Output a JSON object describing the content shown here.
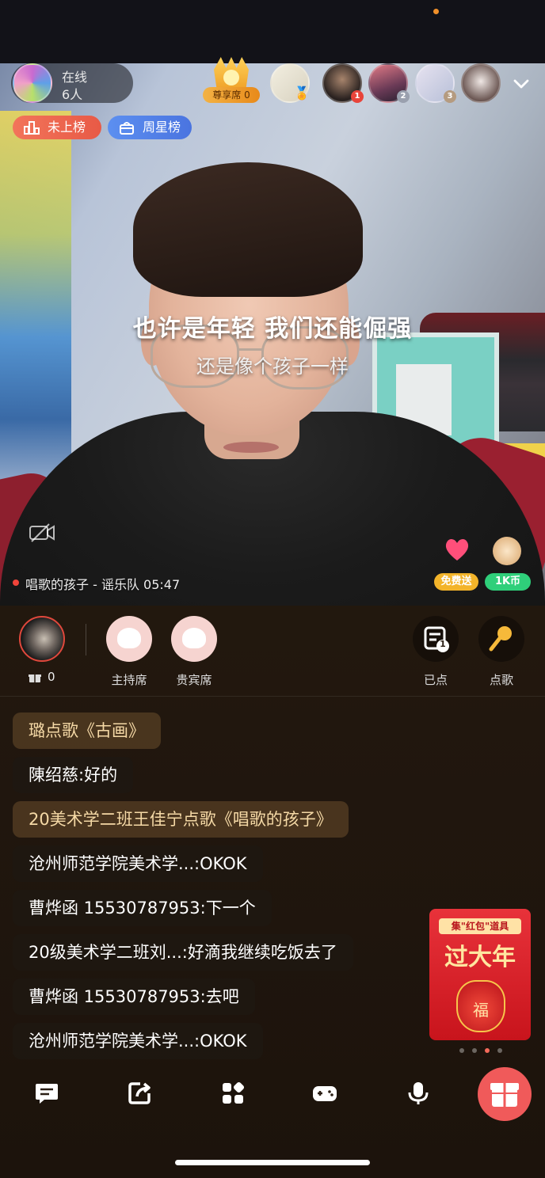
{
  "online": {
    "label": "在线",
    "count": "6人"
  },
  "vip_seat": {
    "label": "尊享席 0"
  },
  "viewers": [
    {
      "rank": ""
    },
    {
      "rank": "1"
    },
    {
      "rank": "2"
    },
    {
      "rank": "3"
    },
    {
      "rank": ""
    }
  ],
  "rank_pills": {
    "rank": "未上榜",
    "star": "周星榜"
  },
  "lyrics": {
    "line1": "也许是年轻 我们还能倔强",
    "line2": "还是像个孩子一样"
  },
  "now_playing": "唱歌的孩子 - 谣乐队 05:47",
  "gifts": {
    "free_label": "免费送",
    "coin_label": "1K币"
  },
  "host": {
    "gift_count": "0"
  },
  "seats": [
    {
      "label": "主持席"
    },
    {
      "label": "贵宾席"
    }
  ],
  "actions": {
    "queue_label": "已点",
    "queue_badge": "1",
    "order_label": "点歌"
  },
  "chat": [
    {
      "text": "璐点歌《古画》",
      "song": true
    },
    {
      "text": "陳绍慈:好的",
      "song": false
    },
    {
      "text": "20美术学二班王佳宁点歌《唱歌的孩子》",
      "song": true
    },
    {
      "text": "沧州师范学院美术学...:OKOK",
      "song": false
    },
    {
      "text": "曹烨函 15530787953:下一个",
      "song": false
    },
    {
      "text": "20级美术学二班刘...:好滴我继续吃饭去了",
      "song": false
    },
    {
      "text": "曹烨函 15530787953:去吧",
      "song": false
    },
    {
      "text": "沧州师范学院美术学...:OKOK",
      "song": false
    }
  ],
  "promo": {
    "top": "集\"红包\"道具",
    "title": "过大年",
    "bag_text": "福"
  },
  "colors": {
    "accent": "#f05a5a",
    "rank_pill": "#e85a46",
    "star_pill": "#4a74e0",
    "song_chat": "#f5d9a6"
  }
}
